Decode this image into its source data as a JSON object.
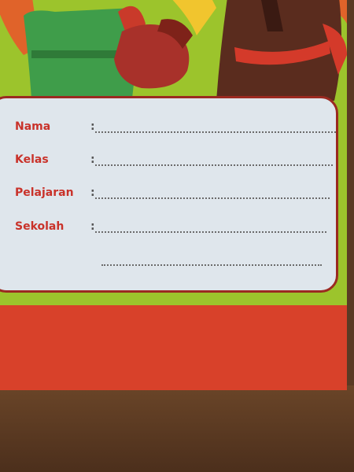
{
  "form": {
    "fields": [
      {
        "label": "Nama",
        "colon": ":"
      },
      {
        "label": "Kelas",
        "colon": ":"
      },
      {
        "label": "Pelajaran",
        "colon": ":"
      },
      {
        "label": "Sekolah",
        "colon": ":"
      }
    ]
  },
  "colors": {
    "cover_green": "#9cc42c",
    "cover_red": "#d8412a",
    "label_text": "#c9322a",
    "card_border": "#9b2a21",
    "card_fill": "#dfe6ec"
  }
}
